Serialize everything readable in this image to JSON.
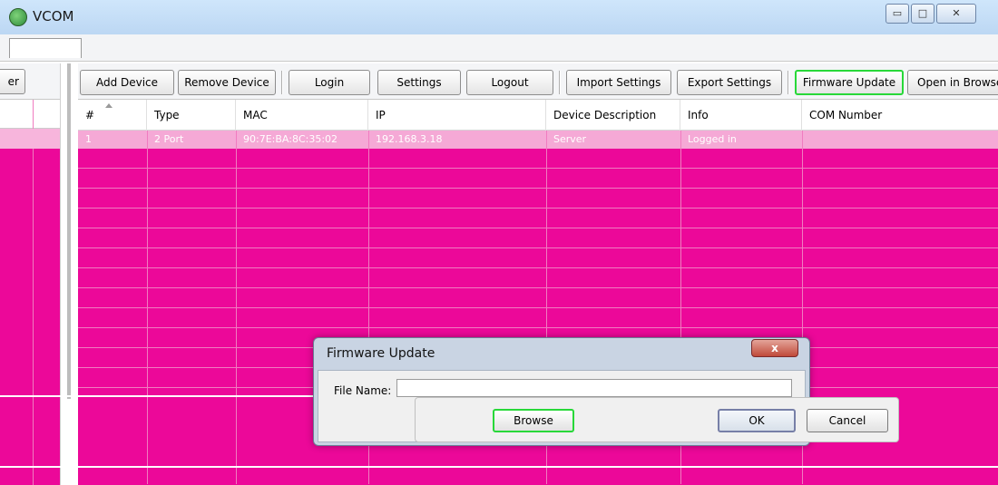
{
  "window": {
    "title": "VCOM",
    "minimize": "▭",
    "maximize": "□",
    "close": "✕"
  },
  "left": {
    "button_label": "er"
  },
  "toolbar": {
    "add_device": "Add Device",
    "remove_device": "Remove Device",
    "login": "Login",
    "settings": "Settings",
    "logout": "Logout",
    "import_settings": "Import Settings",
    "export_settings": "Export Settings",
    "firmware_update": "Firmware Update",
    "open_in_browser": "Open in Browse"
  },
  "table": {
    "columns": [
      "#",
      "Type",
      "MAC",
      "IP",
      "Device Description",
      "Info",
      "COM Number"
    ],
    "rows": [
      [
        "1",
        "2 Port",
        "90:7E:BA:8C:35:02",
        "192.168.3.18",
        "Server",
        "Logged in",
        ""
      ]
    ]
  },
  "dialog": {
    "title": "Firmware Update",
    "close_label": "x",
    "file_name_label": "File Name:",
    "file_name_value": "",
    "browse": "Browse",
    "ok": "OK",
    "cancel": "Cancel"
  },
  "colors": {
    "highlight": "#28d839",
    "grid_bg": "#ec0899",
    "selected_row": "#f5a9d6"
  }
}
